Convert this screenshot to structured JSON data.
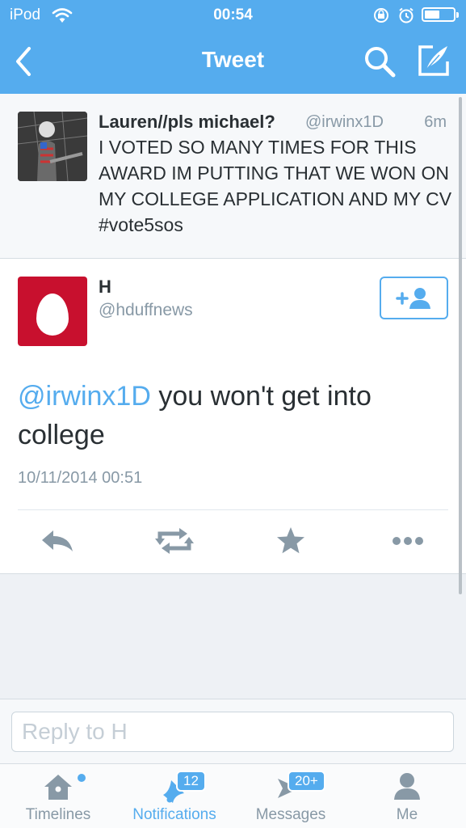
{
  "status_bar": {
    "carrier": "iPod",
    "time": "00:54",
    "icons": [
      "wifi-icon",
      "rotation-lock-icon",
      "alarm-icon",
      "battery-icon"
    ]
  },
  "nav": {
    "title": "Tweet",
    "icons": [
      "back-icon",
      "search-icon",
      "compose-icon"
    ]
  },
  "parent_tweet": {
    "name": "Lauren//pls michael?",
    "handle": "@irwinx1D",
    "age": "6m",
    "text": "I VOTED SO MANY TIMES FOR THIS AWARD IM PUTTING THAT WE WON ON MY COLLEGE APPLICATION AND MY CV #vote5sos"
  },
  "tweet": {
    "name": "H",
    "handle": "@hduffnews",
    "mention": "@irwinx1D",
    "body": " you won't get into college",
    "timestamp": "10/11/2014 00:51",
    "follow_icon": "add-user-icon",
    "actions": [
      "reply-icon",
      "retweet-icon",
      "favorite-icon",
      "more-icon"
    ]
  },
  "reply": {
    "placeholder": "Reply to H"
  },
  "tabs": [
    {
      "label": "Timelines",
      "icon": "home-icon",
      "active": false
    },
    {
      "label": "Notifications",
      "icon": "bell-icon",
      "badge": "12",
      "active": true
    },
    {
      "label": "Messages",
      "icon": "message-icon",
      "badge": "20+",
      "active": false
    },
    {
      "label": "Me",
      "icon": "person-icon",
      "active": false
    }
  ],
  "colors": {
    "brand": "#55acee",
    "text": "#292f33",
    "muted": "#8899a6",
    "avatar_red": "#c8102e"
  }
}
